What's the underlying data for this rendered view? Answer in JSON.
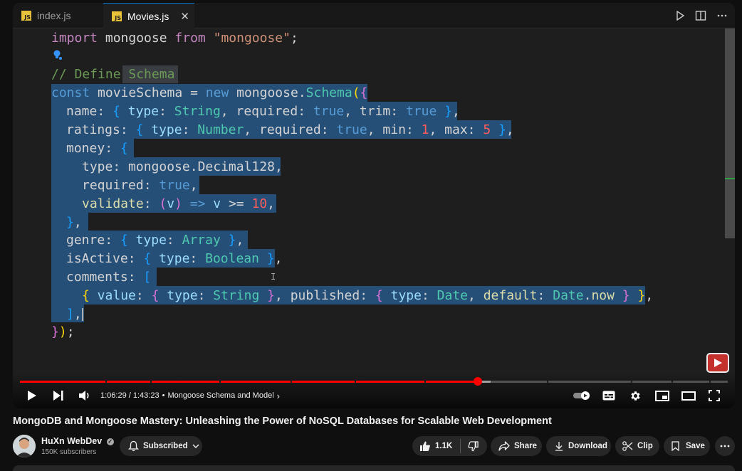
{
  "tabs": [
    {
      "label": "index.js",
      "icon": "JS"
    },
    {
      "label": "Movies.js",
      "icon": "JS",
      "active": true
    }
  ],
  "code": {
    "l1": {
      "kw": "import",
      "id": " mongoose ",
      "kw2": "from",
      "str": "\"mongoose\"",
      "end": ";"
    },
    "comment_a": "// Define",
    "comment_b": " Schema",
    "l3": {
      "const": "const",
      "name": " movieSchema ",
      "eq": "= ",
      "new": "new",
      "obj": " mongoose.",
      "cls": "Schema",
      "open": "({"
    },
    "name_line": [
      "name",
      ": ",
      "{",
      " type",
      ": ",
      "String",
      ", ",
      "required",
      ": ",
      "true",
      ", ",
      "trim",
      ": ",
      "true",
      " ",
      "}",
      ","
    ],
    "ratings_line": [
      "ratings",
      ": ",
      "{",
      " type",
      ": ",
      "Number",
      ", ",
      "required",
      ": ",
      "true",
      ", ",
      "min",
      ": ",
      "1",
      ", ",
      "max",
      ": ",
      "5",
      " ",
      "}",
      ","
    ],
    "money_line": [
      "money",
      ": ",
      "{"
    ],
    "type_line": [
      "type",
      ": mongoose.",
      "Decimal128",
      ","
    ],
    "required_line": [
      "required",
      ": ",
      "true",
      ","
    ],
    "validate_line": [
      "validate",
      ": ",
      "(",
      "v",
      ")",
      " => ",
      "v",
      " >= ",
      "10",
      ","
    ],
    "close_money": [
      "}",
      ","
    ],
    "genre_line": [
      "genre",
      ": ",
      "{",
      " type",
      ": ",
      "Array",
      " ",
      "}",
      ","
    ],
    "isActive_line": [
      "isActive",
      ": ",
      "{",
      " type",
      ": ",
      "Boolean",
      " ",
      "}",
      ","
    ],
    "comments_line": [
      "comments",
      ": ",
      "["
    ],
    "value_line": [
      "{",
      " value",
      ": ",
      "{",
      " type",
      ": ",
      "String",
      " ",
      "}",
      ", ",
      "published",
      ": ",
      "{",
      " type",
      ": ",
      "Date",
      ", ",
      "default",
      ": ",
      "Date",
      ".",
      "now",
      " ",
      "}",
      " ",
      "}",
      ","
    ],
    "close_comments": [
      "]",
      ","
    ],
    "close_all": [
      "}",
      ")",
      ";"
    ]
  },
  "player": {
    "time": "1:06:29 / 1:43:23",
    "chapter": "Mongoose Schema and Model",
    "progress": 0.647
  },
  "video": {
    "title": "MongoDB and Mongoose Mastery: Unleashing the Power of NoSQL Databases for Scalable Web Development"
  },
  "channel": {
    "name": "HuXn WebDev",
    "subscribers": "150K subscribers"
  },
  "actions": {
    "subscribed": "Subscribed",
    "likes": "1.1K",
    "share": "Share",
    "download": "Download",
    "clip": "Clip",
    "save": "Save"
  }
}
